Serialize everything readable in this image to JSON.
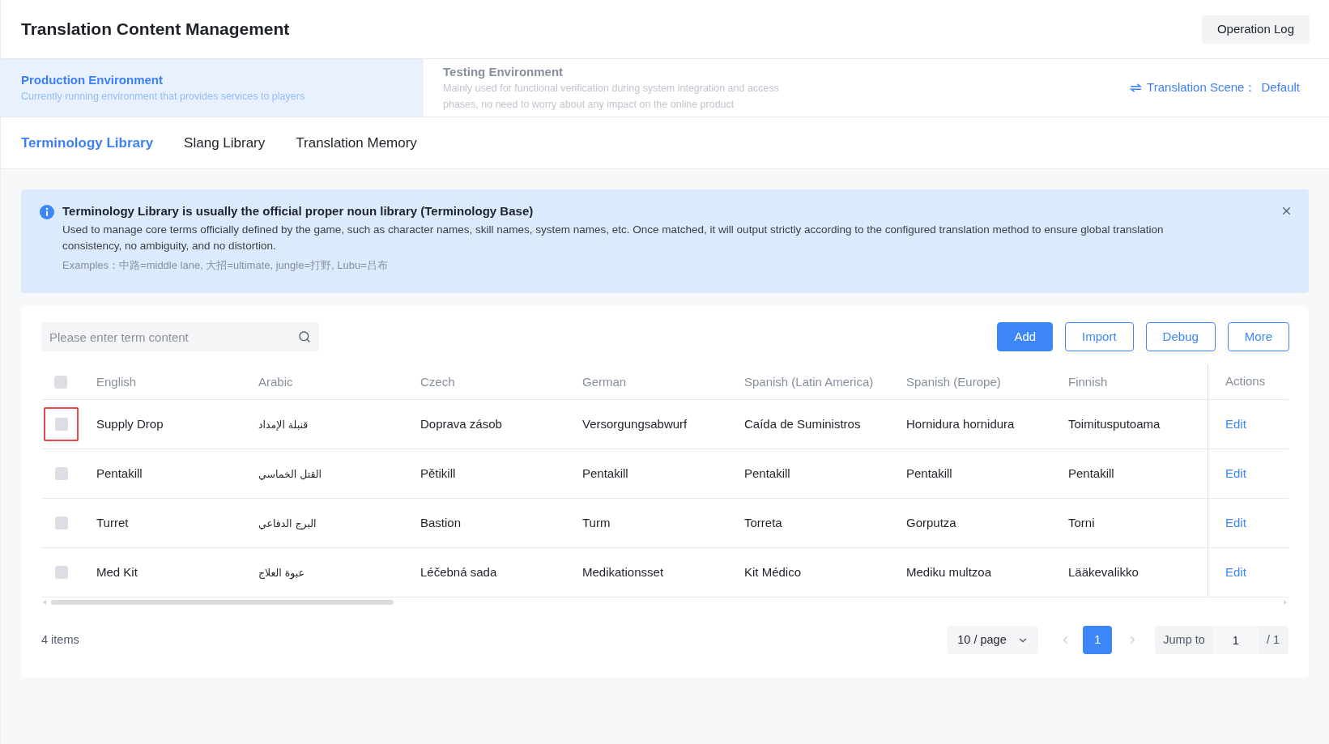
{
  "header": {
    "title": "Translation Content Management",
    "operation_log_button": "Operation Log"
  },
  "environments": [
    {
      "title": "Production Environment",
      "description": "Currently running environment that provides services to players",
      "selected": true
    },
    {
      "title": "Testing Environment",
      "description": "Mainly used for functional verification during system integration and access phases, no need to worry about any impact on the online product",
      "selected": false
    }
  ],
  "translation_scene": {
    "label": "Translation Scene：",
    "value": "Default"
  },
  "tabs": [
    {
      "label": "Terminology Library",
      "selected": true
    },
    {
      "label": "Slang Library",
      "selected": false
    },
    {
      "label": "Translation Memory",
      "selected": false
    }
  ],
  "notice": {
    "title": "Terminology Library is usually the official proper noun library (Terminology Base)",
    "body": "Used to manage core terms officially defined by the game, such as character names, skill names, system names, etc. Once matched, it will output strictly according to the configured translation method to ensure global translation consistency, no ambiguity, and no distortion.",
    "examples": "Examples：中路=middle lane, 大招=ultimate, jungle=打野, Lubu=吕布"
  },
  "search": {
    "placeholder": "Please enter term content"
  },
  "buttons": [
    {
      "label": "Add",
      "kind": "primary"
    },
    {
      "label": "Import",
      "kind": "outline"
    },
    {
      "label": "Debug",
      "kind": "outline"
    },
    {
      "label": "More",
      "kind": "outline"
    }
  ],
  "table": {
    "select_all_checked": false,
    "columns": [
      {
        "label": "English",
        "kind": "latin"
      },
      {
        "label": "Arabic",
        "kind": "arabic"
      },
      {
        "label": "Czech",
        "kind": "latin"
      },
      {
        "label": "German",
        "kind": "latin"
      },
      {
        "label": "Spanish (Latin America)",
        "kind": "latin"
      },
      {
        "label": "Spanish (Europe)",
        "kind": "latin"
      },
      {
        "label": "Finnish",
        "kind": "latin"
      }
    ],
    "actions_column": "Actions",
    "rows": [
      {
        "checked": false,
        "highlighted": true,
        "cells": [
          "Supply Drop",
          "قنبلة الإمداد",
          "Doprava zásob",
          "Versorgungsabwurf",
          "Caída de Suministros",
          "Hornidura hornidura",
          "Toimitusputoama"
        ],
        "action": "Edit"
      },
      {
        "checked": false,
        "highlighted": false,
        "cells": [
          "Pentakill",
          "القتل الخماسي",
          "Pětikill",
          "Pentakill",
          "Pentakill",
          "Pentakill",
          "Pentakill"
        ],
        "action": "Edit"
      },
      {
        "checked": false,
        "highlighted": false,
        "cells": [
          "Turret",
          "البرج الدفاعي",
          "Bastion",
          "Turm",
          "Torreta",
          "Gorputza",
          "Torni"
        ],
        "action": "Edit"
      },
      {
        "checked": false,
        "highlighted": false,
        "cells": [
          "Med Kit",
          "عبوة العلاج",
          "Léčebná sada",
          "Medikationsset",
          "Kit Médico",
          "Mediku multzoa",
          "Lääkevalikko"
        ],
        "action": "Edit"
      }
    ]
  },
  "pagination": {
    "total": "4 items",
    "page_size": "10 / page",
    "prev_disabled": true,
    "pages": [
      {
        "label": "1",
        "selected": true
      }
    ],
    "next_disabled": true,
    "jump_label": "Jump to",
    "jump_value": "1",
    "page_count": "/ 1"
  }
}
